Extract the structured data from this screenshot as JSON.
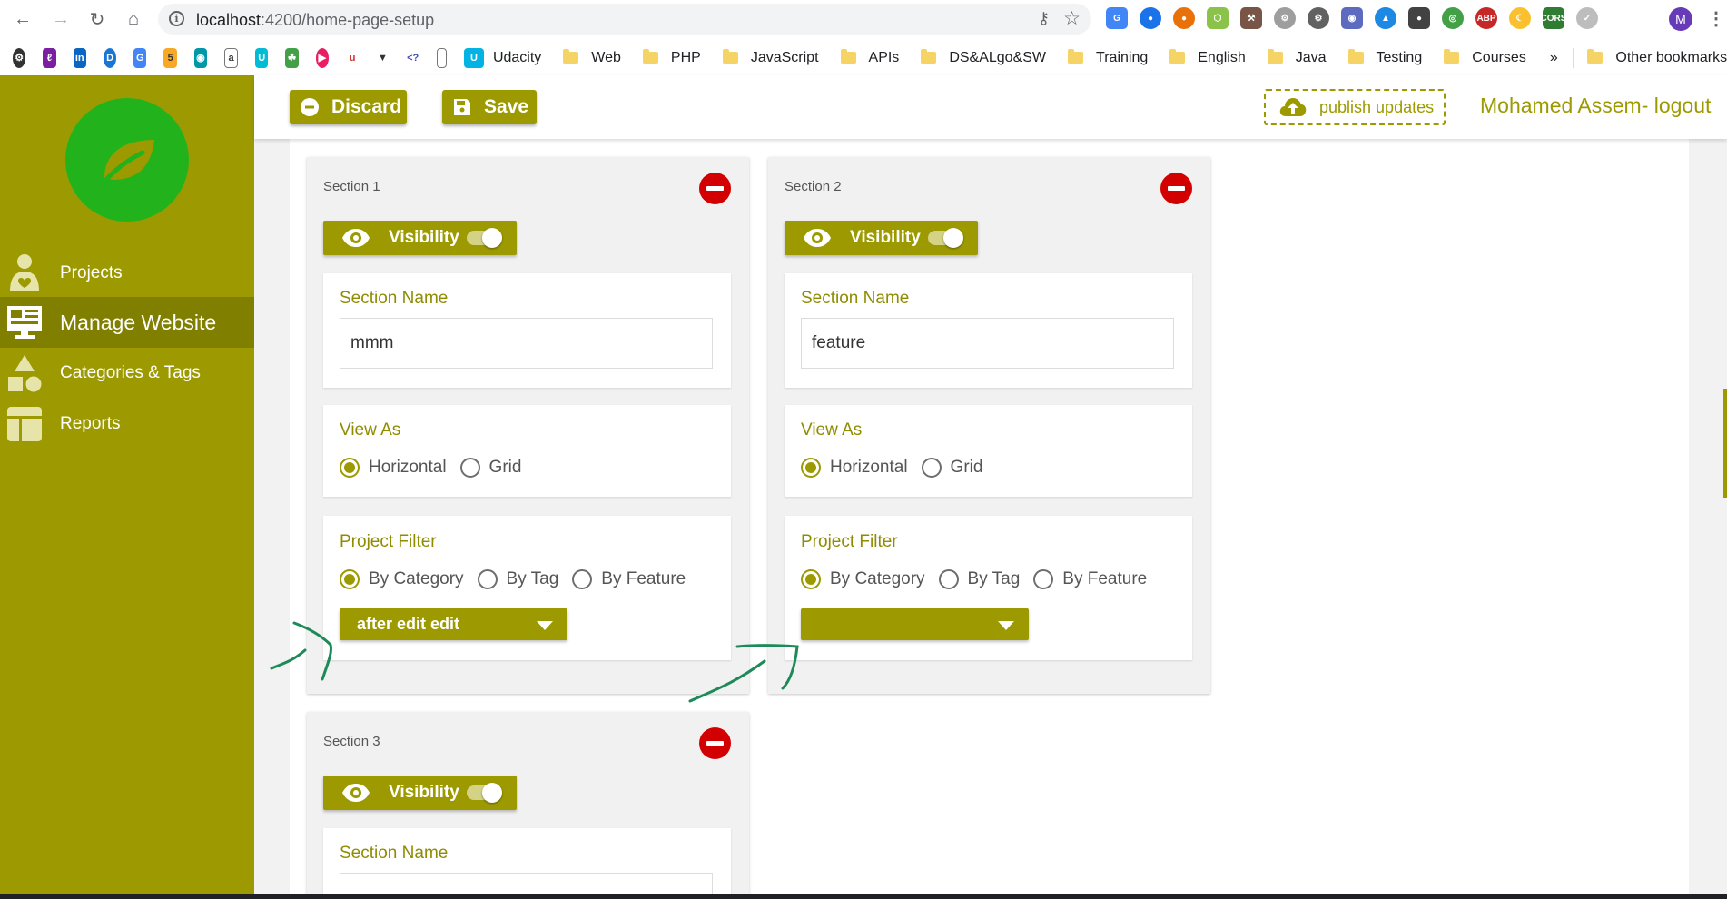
{
  "browser": {
    "url_host": "localhost",
    "url_path": ":4200/home-page-setup",
    "profile_initial": "M",
    "bookmarks": [
      {
        "label": "Udacity",
        "type": "site"
      },
      {
        "label": "Web",
        "type": "folder"
      },
      {
        "label": "PHP",
        "type": "folder"
      },
      {
        "label": "JavaScript",
        "type": "folder"
      },
      {
        "label": "APIs",
        "type": "folder"
      },
      {
        "label": "DS&ALgo&SW",
        "type": "folder"
      },
      {
        "label": "Training",
        "type": "folder"
      },
      {
        "label": "English",
        "type": "folder"
      },
      {
        "label": "Java",
        "type": "folder"
      },
      {
        "label": "Testing",
        "type": "folder"
      },
      {
        "label": "Courses",
        "type": "folder"
      }
    ],
    "overflow": "»",
    "other_bookmarks": "Other bookmarks"
  },
  "colors": {
    "accent": "#9c9a00",
    "accent_dark": "#817f00",
    "logo_green": "#22b31c",
    "remove_red": "#d20000",
    "annotation_green": "#1e8a5a"
  },
  "sidebar": {
    "items": [
      {
        "label": "Projects",
        "icon": "projects-icon"
      },
      {
        "label": "Manage Website",
        "icon": "monitor-icon",
        "active": true
      },
      {
        "label": "Categories & Tags",
        "icon": "shapes-icon"
      },
      {
        "label": "Reports",
        "icon": "layout-icon"
      }
    ]
  },
  "toolbar": {
    "discard_label": "Discard",
    "save_label": "Save",
    "publish_label": "publish updates",
    "user_label": "Mohamed Assem- logout"
  },
  "sections": [
    {
      "title": "Section 1",
      "visibility_label": "Visibility",
      "visible": true,
      "name_label": "Section Name",
      "name_value": "mmm",
      "view_label": "View As",
      "view_options": [
        "Horizontal",
        "Grid"
      ],
      "view_selected": "Horizontal",
      "filter_label": "Project Filter",
      "filter_options": [
        "By Category",
        "By Tag",
        "By Feature"
      ],
      "filter_selected": "By Category",
      "dropdown_value": "after edit edit"
    },
    {
      "title": "Section 2",
      "visibility_label": "Visibility",
      "visible": true,
      "name_label": "Section Name",
      "name_value": "feature",
      "view_label": "View As",
      "view_options": [
        "Horizontal",
        "Grid"
      ],
      "view_selected": "Horizontal",
      "filter_label": "Project Filter",
      "filter_options": [
        "By Category",
        "By Tag",
        "By Feature"
      ],
      "filter_selected": "By Category",
      "dropdown_value": ""
    },
    {
      "title": "Section 3",
      "visibility_label": "Visibility",
      "visible": true,
      "name_label": "Section Name"
    }
  ]
}
